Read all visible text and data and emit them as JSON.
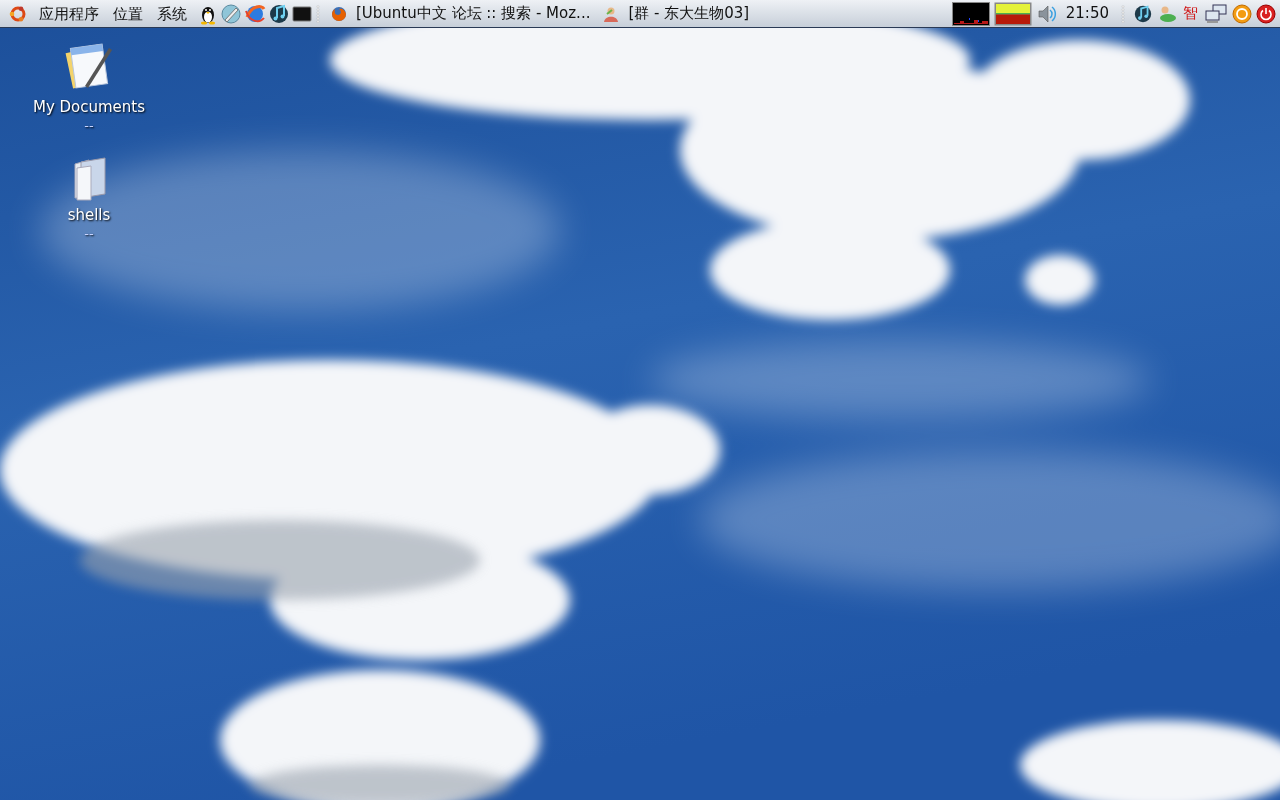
{
  "panel": {
    "menus": [
      "应用程序",
      "位置",
      "系统"
    ],
    "tasks": [
      "[Ubuntu中文 论坛 :: 搜索 - Moz...",
      "[群 - 东大生物03]"
    ],
    "clock": "21:50",
    "input_method": "智"
  },
  "desktop_icons": [
    {
      "label": "My Documents",
      "caption": "--"
    },
    {
      "label": "shells",
      "caption": "--"
    }
  ]
}
